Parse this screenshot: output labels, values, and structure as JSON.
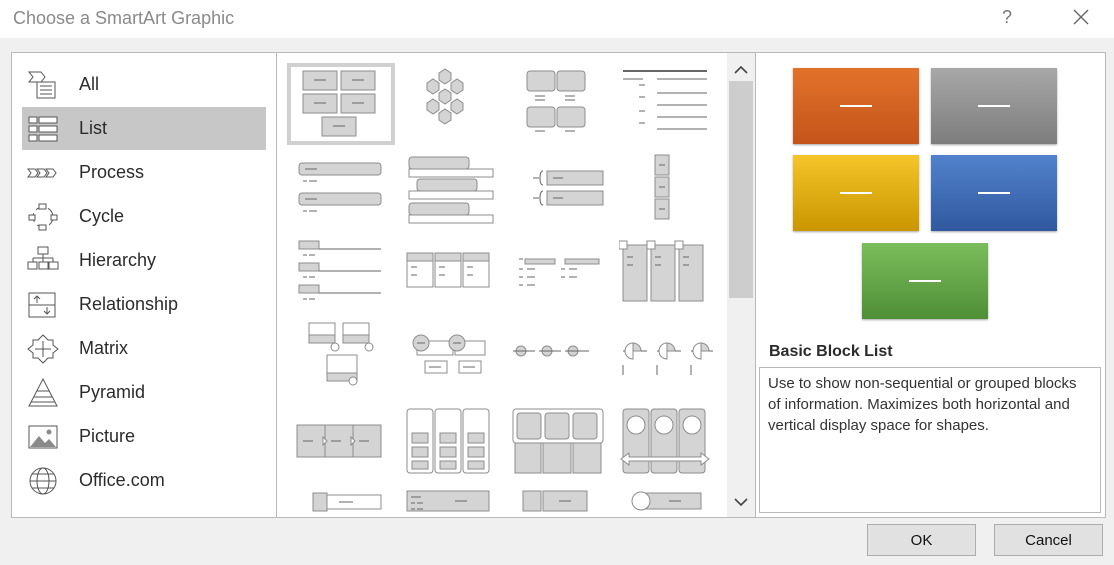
{
  "window": {
    "title": "Choose a SmartArt Graphic",
    "help_label": "?"
  },
  "categories": [
    {
      "label": "All",
      "icon": "all-icon"
    },
    {
      "label": "List",
      "icon": "list-icon",
      "selected": true
    },
    {
      "label": "Process",
      "icon": "process-icon"
    },
    {
      "label": "Cycle",
      "icon": "cycle-icon"
    },
    {
      "label": "Hierarchy",
      "icon": "hierarchy-icon"
    },
    {
      "label": "Relationship",
      "icon": "relationship-icon"
    },
    {
      "label": "Matrix",
      "icon": "matrix-icon"
    },
    {
      "label": "Pyramid",
      "icon": "pyramid-icon"
    },
    {
      "label": "Picture",
      "icon": "picture-icon"
    },
    {
      "label": "Office.com",
      "icon": "globe-icon"
    }
  ],
  "preview": {
    "title": "Basic Block List",
    "description": "Use to show non-sequential or grouped blocks of information. Maximizes both horizontal and vertical display space for shapes.",
    "block_colors": [
      "#d2601a",
      "#8c8c8c",
      "#e6b000",
      "#3d69b4",
      "#5fa046"
    ]
  },
  "buttons": {
    "ok": "OK",
    "cancel": "Cancel"
  }
}
